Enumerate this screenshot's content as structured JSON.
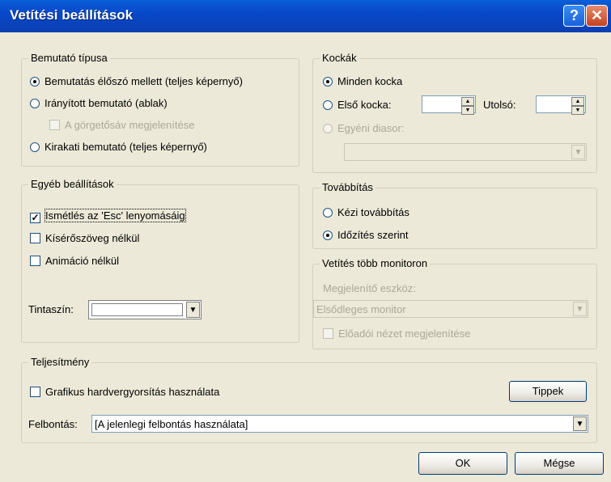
{
  "window": {
    "title": "Vetítési beállítások",
    "help_label": "?",
    "close_label": "✕"
  },
  "show_type": {
    "legend": "Bemutató típusa",
    "presenter": "Bemutatás élőszó mellett (teljes képernyő)",
    "browsed": "Irányított bemutató (ablak)",
    "scrollbar": "A görgetősáv megjelenítése",
    "kiosk": "Kirakati bemutató (teljes képernyő)"
  },
  "slides": {
    "legend": "Kockák",
    "all": "Minden kocka",
    "from": "Első kocka:",
    "to": "Utolsó:",
    "custom": "Egyéni diasor:",
    "from_value": "",
    "to_value": "",
    "custom_value": ""
  },
  "other": {
    "legend": "Egyéb beállítások",
    "loop": "Ismétlés az 'Esc' lenyomásáig",
    "loop_mark": "✓",
    "no_narration": "Kísérőszöveg nélkül",
    "no_animation": "Animáció nélkül",
    "pen_color": "Tintaszín:",
    "pen_color_value": "#FFFFFF"
  },
  "advance": {
    "legend": "Továbbítás",
    "manual": "Kézi továbbítás",
    "timings": "Időzítés szerint"
  },
  "monitors": {
    "legend": "Vetítés több monitoron",
    "display_label": "Megjelenítő eszköz:",
    "display_value": "Elsődleges monitor",
    "presenter_view": "Előadói nézet megjelenítése"
  },
  "performance": {
    "legend": "Teljesítmény",
    "hw_accel": "Grafikus hardvergyorsítás használata",
    "tips": "Tippek",
    "resolution_label": "Felbontás:",
    "resolution_value": "[A jelenlegi felbontás használata]"
  },
  "buttons": {
    "ok": "OK",
    "cancel": "Mégse"
  },
  "icons": {
    "dropdown_arrow": "▼",
    "spin_up": "▲",
    "spin_down": "▼"
  }
}
